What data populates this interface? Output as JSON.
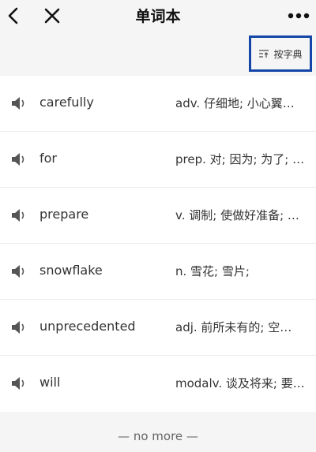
{
  "nav": {
    "title": "单词本"
  },
  "sort": {
    "label": "按字典"
  },
  "words": [
    {
      "word": "carefully",
      "definition": "adv. 仔细地; 小心翼…"
    },
    {
      "word": "for",
      "definition": "prep. 对; 因为; 为了; …"
    },
    {
      "word": "prepare",
      "definition": "v. 调制; 使做好准备; …"
    },
    {
      "word": "snowflake",
      "definition": "n. 雪花; 雪片;"
    },
    {
      "word": "unprecedented",
      "definition": "adj. 前所未有的; 空…"
    },
    {
      "word": "will",
      "definition": "modalv. 谈及将来; 要…"
    }
  ],
  "footer": {
    "text": "— no more —"
  },
  "colors": {
    "highlight_border": "#1446a8",
    "background": "#f5f5f5",
    "row_background": "#ffffff"
  }
}
